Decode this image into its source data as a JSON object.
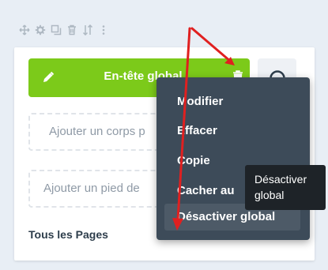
{
  "toolbar": {
    "icons": [
      "move-icon",
      "gear-icon",
      "duplicate-icon",
      "delete-icon",
      "sort-icon",
      "more-icon"
    ]
  },
  "header": {
    "title": "En-tête global",
    "color": "#7cca1a"
  },
  "layout": {
    "body_placeholder": "Ajouter un corps p",
    "footer_placeholder": "Ajouter un pied de",
    "assignment": "Tous les Pages"
  },
  "context_menu": {
    "items": [
      {
        "label": "Modifier"
      },
      {
        "label": "Effacer"
      },
      {
        "label": "Copie"
      },
      {
        "label": "Cacher au"
      },
      {
        "label": "Désactiver global"
      }
    ]
  },
  "tooltip": {
    "line1": "Désactiver",
    "line2": "global"
  },
  "colors": {
    "menu_bg": "#3d4b59",
    "tooltip_bg": "#1e2328",
    "annotation_red": "#e02020"
  }
}
